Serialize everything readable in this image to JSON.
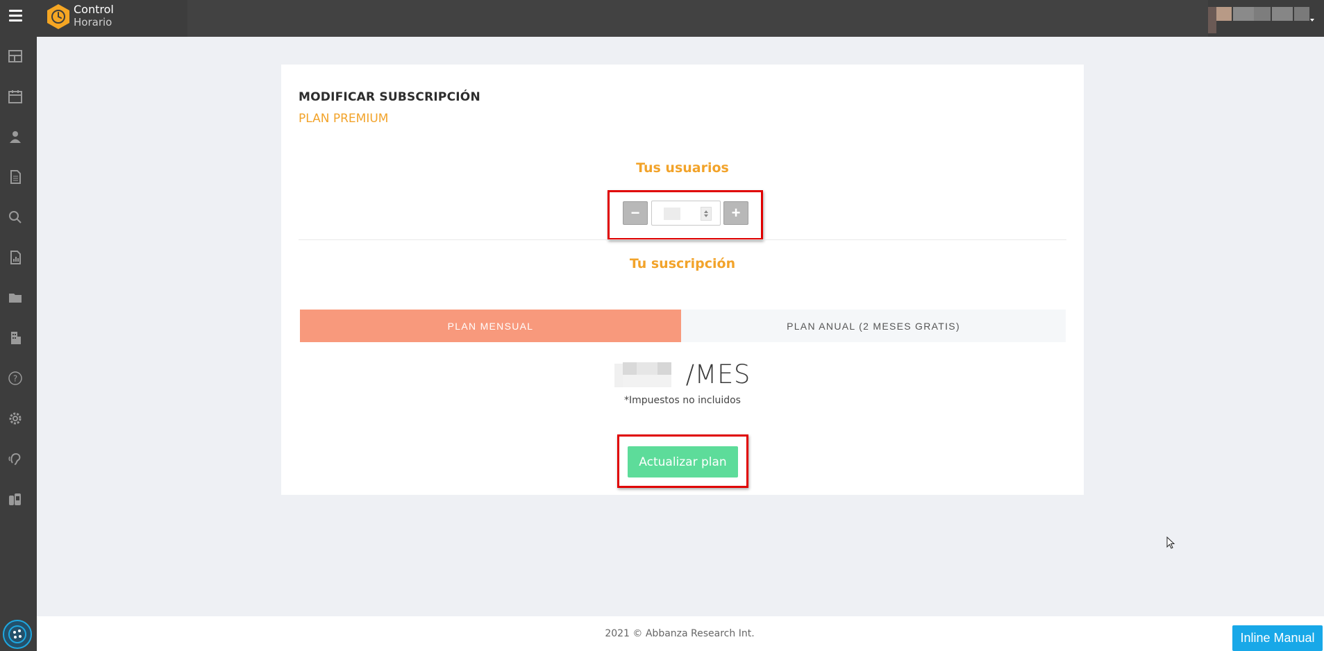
{
  "header": {
    "brand_line1": "Control",
    "brand_line2": "Horario",
    "logo_color": "#f5a623",
    "menu_icon": "hamburger-icon"
  },
  "sidebar": {
    "items": [
      {
        "icon": "dashboard-icon"
      },
      {
        "icon": "calendar-icon"
      },
      {
        "icon": "user-icon"
      },
      {
        "icon": "document-icon"
      },
      {
        "icon": "search-icon"
      },
      {
        "icon": "report-icon"
      },
      {
        "icon": "folder-icon"
      },
      {
        "icon": "building-icon"
      },
      {
        "icon": "help-icon"
      },
      {
        "icon": "gear-icon"
      },
      {
        "icon": "hearing-icon"
      },
      {
        "icon": "people-icon"
      }
    ],
    "bottom_icon": "inline-manual-widget-icon"
  },
  "card": {
    "title": "MODIFICAR SUBSCRIPCIÓN",
    "subtitle": "PLAN PREMIUM",
    "users_heading": "Tus usuarios",
    "stepper": {
      "minus_label": "−",
      "plus_label": "+"
    },
    "subscription_heading": "Tu suscripción",
    "tabs": [
      {
        "label": "PLAN MENSUAL",
        "active": true
      },
      {
        "label": "PLAN ANUAL (2 MESES GRATIS)",
        "active": false
      }
    ],
    "price_unit": "/MES",
    "tax_note": "*Impuestos no incluidos",
    "update_button": "Actualizar plan"
  },
  "footer": {
    "copyright": "2021 © Abbanza Research Int."
  },
  "inline_manual": {
    "label": "Inline Manual"
  },
  "colors": {
    "accent_orange": "#f2a32a",
    "active_tab": "#f8997c",
    "update_green": "#5ddc9a",
    "highlight_red": "#e00000",
    "inline_manual_blue": "#18a8e8"
  }
}
